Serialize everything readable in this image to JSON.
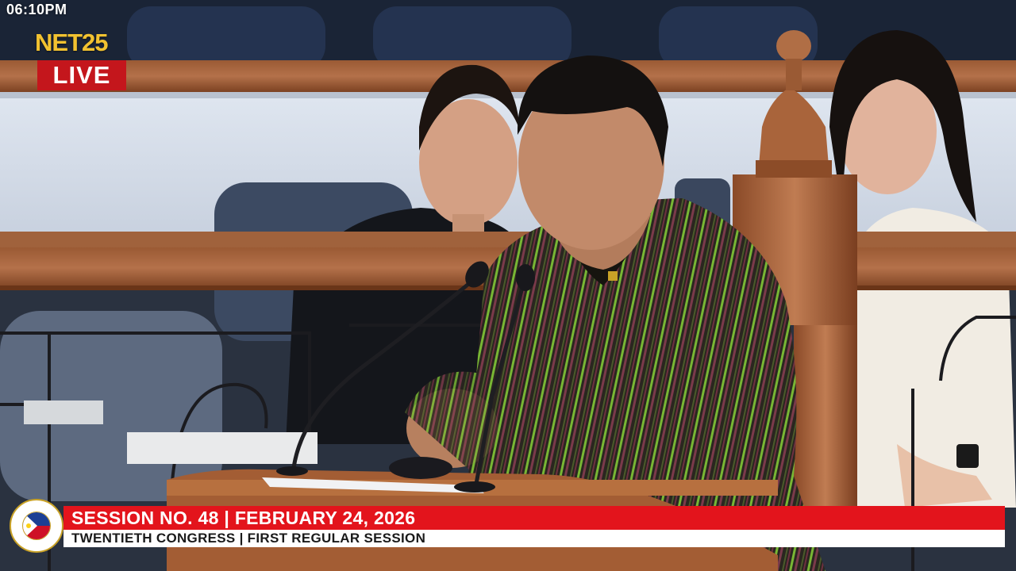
{
  "overlay": {
    "clock": "06:10PM",
    "channel_logo": "NET25",
    "live_badge": "LIVE"
  },
  "lower_third": {
    "headline": "SESSION NO. 48 | FEBRUARY 24, 2026",
    "subline": "TWENTIETH CONGRESS | FIRST REGULAR SESSION",
    "seal_name": "senate-of-the-philippines-seal",
    "seal_text": "SENATE OF THE PHILIPPINES OFFICIAL SEAL"
  },
  "colors": {
    "live_red": "#c4161c",
    "banner_red": "#e3141c",
    "logo_gold": "#f2c230",
    "shirt_green": "#6fb52e"
  }
}
